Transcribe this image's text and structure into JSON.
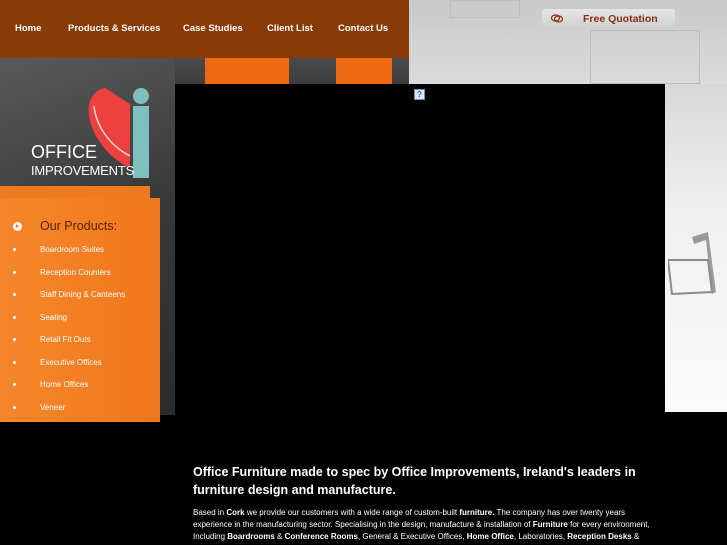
{
  "nav": {
    "items": [
      {
        "label": "Home"
      },
      {
        "label": "Products & Services"
      },
      {
        "label": "Case Studies"
      },
      {
        "label": "Client List"
      },
      {
        "label": "Contact Us"
      }
    ]
  },
  "quote": {
    "label": "Free Quotation",
    "icon": "chat-bubbles-icon"
  },
  "logo": {
    "line1": "OFFICE",
    "line2": "IMPROVEMENTS"
  },
  "products": {
    "title": "Our Products:",
    "items": [
      {
        "label": "Boardroom Suites"
      },
      {
        "label": "Reception Counters"
      },
      {
        "label": "Staff Dining & Canteens"
      },
      {
        "label": "Seating"
      },
      {
        "label": "Retail Fit Outs"
      },
      {
        "label": "Executive Offices"
      },
      {
        "label": "Home Offices"
      },
      {
        "label": "Veneer"
      }
    ]
  },
  "video": {
    "plugin_icon": "?"
  },
  "content": {
    "heading": "Office Furniture made to spec by Office Improvements, Ireland's leaders in furniture design and manufacture.",
    "p_parts": [
      "Based in ",
      "Cork",
      " we provide our customers with a wide range of custom-built ",
      "furniture.",
      " The company has over twenty years experience in the manufacturing sector. Specialising in the design, manufacture & installation of ",
      "Furniture",
      " for every environment, Including ",
      "Boardrooms",
      " & ",
      "Conference Rooms",
      ", General & Executive Offices, ",
      "Home Office",
      ", Laboratories, ",
      "Reception Desks",
      " &"
    ]
  },
  "colors": {
    "nav_bg": "#8a3a05",
    "accent_orange": "#f07a20",
    "quote_text": "#8a2e0d"
  }
}
